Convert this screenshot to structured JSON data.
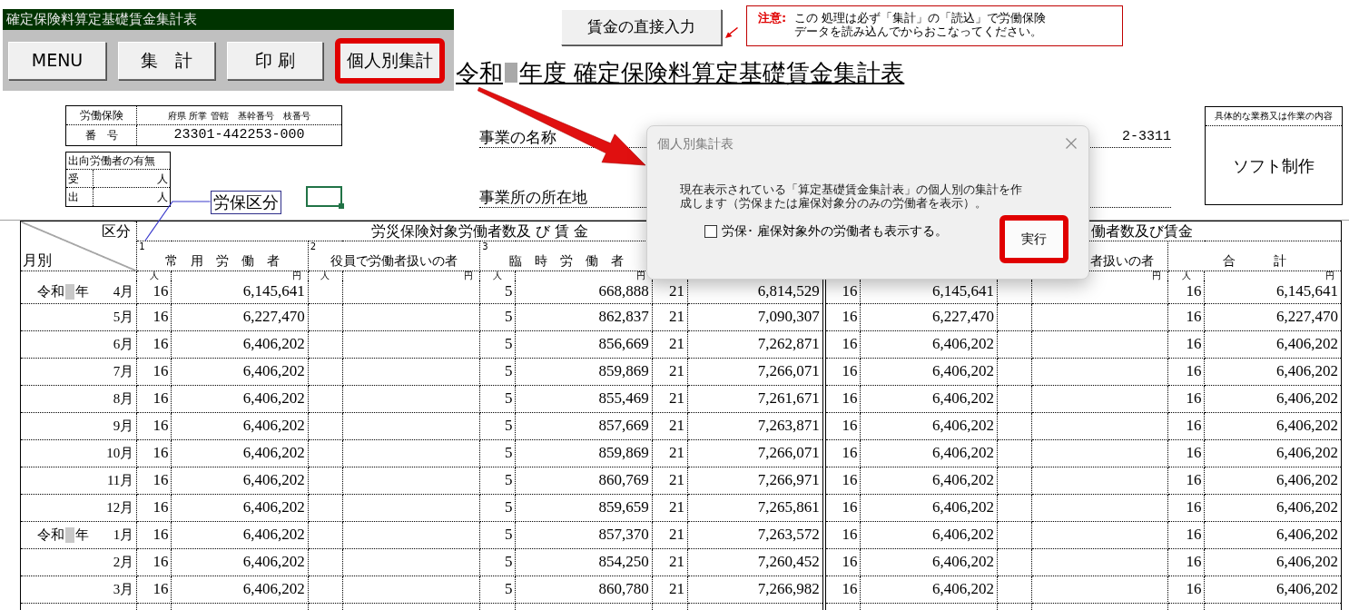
{
  "toolbar": {
    "title": "確定保険料算定基礎賃金集計表",
    "buttons": [
      {
        "label": "MENU",
        "highlighted": false
      },
      {
        "label": "集　計",
        "highlighted": false
      },
      {
        "label": "印 刷",
        "highlighted": false
      },
      {
        "label": "個人別集計",
        "highlighted": true
      }
    ]
  },
  "direct_input_button": {
    "label": "賃金の直接入力"
  },
  "notice": {
    "heading": "注意:",
    "lines": [
      "この 処理は必ず「集計」の「読込」で労働保険",
      "データを読み込んでからおこなってください。"
    ]
  },
  "title": {
    "era": "令和",
    "text": "年度 確定保険料算定基礎賃金集計表"
  },
  "insurance_number": {
    "label": "労働保険",
    "label_2": "番　号",
    "field_header": "府県 所掌 管轄　基幹番号　枝番号",
    "value": "23301-442253-000"
  },
  "secondment": {
    "heading": "出向労働者の有無",
    "rows": [
      {
        "label": "受",
        "unit": "人"
      },
      {
        "label": "出",
        "unit": "人"
      }
    ]
  },
  "category_label": "労保区分",
  "business_fields": [
    {
      "label": "事業の名称",
      "value": "2-3311"
    },
    {
      "label": "事業所の所在地"
    }
  ],
  "work_content": {
    "heading": "具体的な業務又は作業の内容",
    "value": "ソフト制作"
  },
  "table": {
    "corner": {
      "top": "区分",
      "bottom": "月別"
    },
    "groups": [
      {
        "title": "労災保険対象労働者数及 び 賃 金",
        "columns": [
          {
            "number": "1",
            "label": "常　用　労　働　者",
            "person_unit": "人",
            "wage_unit": "円"
          },
          {
            "number": "2",
            "label": "役員で労働者扱いの者",
            "person_unit": "人",
            "wage_unit": "円"
          },
          {
            "number": "3",
            "label": "臨　時　労　働　者",
            "person_unit": "人",
            "wage_unit": "円"
          },
          null
        ]
      },
      {
        "title": "働者数及び賃金",
        "columns": [
          null,
          {
            "label": "者扱いの者",
            "wage_unit": "円"
          },
          {
            "label": "合　　　計",
            "person_unit": "人",
            "wage_unit": "円"
          }
        ]
      }
    ],
    "rows": [
      {
        "era": "令和",
        "year": "年",
        "month": "4月",
        "cells": [
          [
            "16",
            "6,145,641"
          ],
          null,
          [
            "5",
            "668,888"
          ],
          [
            "21",
            "6,814,529"
          ],
          [
            "16",
            "6,145,641"
          ],
          null,
          [
            "16",
            "6,145,641"
          ]
        ]
      },
      {
        "month": "5月",
        "cells": [
          [
            "16",
            "6,227,470"
          ],
          null,
          [
            "5",
            "862,837"
          ],
          [
            "21",
            "7,090,307"
          ],
          [
            "16",
            "6,227,470"
          ],
          null,
          [
            "16",
            "6,227,470"
          ]
        ]
      },
      {
        "month": "6月",
        "cells": [
          [
            "16",
            "6,406,202"
          ],
          null,
          [
            "5",
            "856,669"
          ],
          [
            "21",
            "7,262,871"
          ],
          [
            "16",
            "6,406,202"
          ],
          null,
          [
            "16",
            "6,406,202"
          ]
        ]
      },
      {
        "month": "7月",
        "cells": [
          [
            "16",
            "6,406,202"
          ],
          null,
          [
            "5",
            "859,869"
          ],
          [
            "21",
            "7,266,071"
          ],
          [
            "16",
            "6,406,202"
          ],
          null,
          [
            "16",
            "6,406,202"
          ]
        ]
      },
      {
        "month": "8月",
        "cells": [
          [
            "16",
            "6,406,202"
          ],
          null,
          [
            "5",
            "855,469"
          ],
          [
            "21",
            "7,261,671"
          ],
          [
            "16",
            "6,406,202"
          ],
          null,
          [
            "16",
            "6,406,202"
          ]
        ]
      },
      {
        "month": "9月",
        "cells": [
          [
            "16",
            "6,406,202"
          ],
          null,
          [
            "5",
            "857,669"
          ],
          [
            "21",
            "7,263,871"
          ],
          [
            "16",
            "6,406,202"
          ],
          null,
          [
            "16",
            "6,406,202"
          ]
        ]
      },
      {
        "month": "10月",
        "cells": [
          [
            "16",
            "6,406,202"
          ],
          null,
          [
            "5",
            "859,869"
          ],
          [
            "21",
            "7,266,071"
          ],
          [
            "16",
            "6,406,202"
          ],
          null,
          [
            "16",
            "6,406,202"
          ]
        ]
      },
      {
        "month": "11月",
        "cells": [
          [
            "16",
            "6,406,202"
          ],
          null,
          [
            "5",
            "860,769"
          ],
          [
            "21",
            "7,266,971"
          ],
          [
            "16",
            "6,406,202"
          ],
          null,
          [
            "16",
            "6,406,202"
          ]
        ]
      },
      {
        "month": "12月",
        "cells": [
          [
            "16",
            "6,406,202"
          ],
          null,
          [
            "5",
            "859,659"
          ],
          [
            "21",
            "7,265,861"
          ],
          [
            "16",
            "6,406,202"
          ],
          null,
          [
            "16",
            "6,406,202"
          ]
        ]
      },
      {
        "era": "令和",
        "year": "年",
        "month": "1月",
        "cells": [
          [
            "16",
            "6,406,202"
          ],
          null,
          [
            "5",
            "857,370"
          ],
          [
            "21",
            "7,263,572"
          ],
          [
            "16",
            "6,406,202"
          ],
          null,
          [
            "16",
            "6,406,202"
          ]
        ]
      },
      {
        "month": "2月",
        "cells": [
          [
            "16",
            "6,406,202"
          ],
          null,
          [
            "5",
            "854,250"
          ],
          [
            "21",
            "7,260,452"
          ],
          [
            "16",
            "6,406,202"
          ],
          null,
          [
            "16",
            "6,406,202"
          ]
        ]
      },
      {
        "month": "3月",
        "cells": [
          [
            "16",
            "6,406,202"
          ],
          null,
          [
            "5",
            "860,780"
          ],
          [
            "21",
            "7,266,982"
          ],
          [
            "16",
            "6,406,202"
          ],
          null,
          [
            "16",
            "6,406,202"
          ]
        ]
      }
    ]
  },
  "dialog": {
    "title": "個人別集計表",
    "message_lines": [
      "現在表示されている「算定基礎賃金集計表」の個人別の集計を作",
      "成します（労保または雇保対象分のみの労働者を表示）。"
    ],
    "checkbox": {
      "label": "労保･ 雇保対象外の労働者も表示する。",
      "checked": false
    },
    "button": {
      "label": "実行",
      "highlighted": true
    }
  }
}
